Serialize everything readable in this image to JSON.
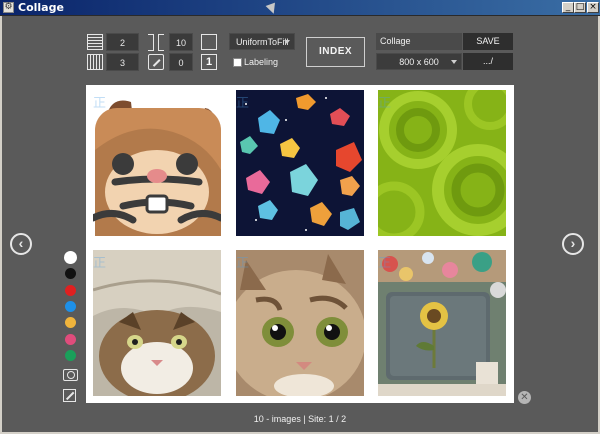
{
  "window": {
    "title": "Collage",
    "app_icon": "collage-app-icon"
  },
  "toolbar": {
    "rows": "2",
    "cols": "3",
    "spacing": "10",
    "rotation": "0",
    "stretch_mode": "UniformToFill",
    "labeling_label": "Labeling",
    "labeling_checked": false,
    "index_label": "INDEX",
    "collage_name": "Collage",
    "save_label": "SAVE",
    "size": "800 x 600",
    "path_label": ".../"
  },
  "images": [
    {
      "name": "squirrel-illustration",
      "watermark": "正"
    },
    {
      "name": "gem-space-pattern",
      "watermark": "正"
    },
    {
      "name": "green-spiral-pattern",
      "watermark": "正"
    },
    {
      "name": "cat-under-blanket",
      "watermark": "正"
    },
    {
      "name": "kitten-closeup",
      "watermark": "正"
    },
    {
      "name": "sunflower-drawing-garden",
      "watermark": "正"
    }
  ],
  "palette": [
    {
      "name": "white",
      "color": "#ffffff"
    },
    {
      "name": "black",
      "color": "#111111"
    },
    {
      "name": "red",
      "color": "#e02020"
    },
    {
      "name": "blue",
      "color": "#1e90e8"
    },
    {
      "name": "yellow",
      "color": "#f0b43c"
    },
    {
      "name": "pink",
      "color": "#e04c7c"
    },
    {
      "name": "green",
      "color": "#1aa05a"
    }
  ],
  "status": "10 - images | Site: 1 / 2"
}
